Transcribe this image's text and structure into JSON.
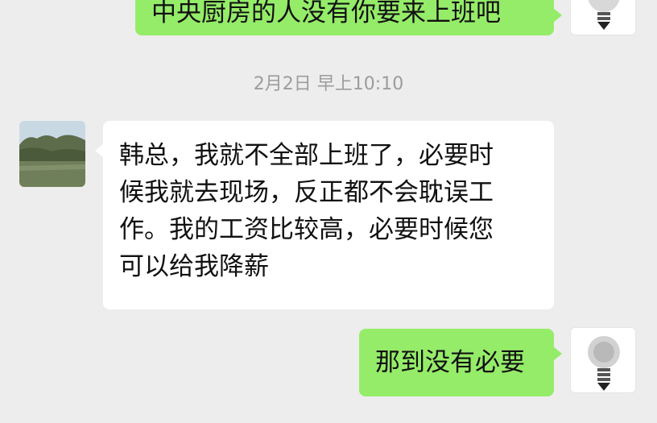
{
  "chat": {
    "messages": [
      {
        "sender": "self",
        "text": "中央厨房的人没有你要来上班吧"
      },
      {
        "sender": "other",
        "lines": [
          "韩总，我就不全部上班了，必要时",
          "候我就去现场，反正都不会耽误工",
          "作。我的工资比较高，必要时候您",
          "可以给我降薪"
        ]
      },
      {
        "sender": "self",
        "text": "那到没有必要"
      }
    ],
    "timestamp": "2月2日 早上10:10"
  },
  "colors": {
    "background": "#ededed",
    "outgoing_bubble": "#95ec69",
    "incoming_bubble": "#ffffff",
    "timestamp_text": "#9c9c9c"
  },
  "avatars": {
    "self": "lightbulb-idea-avatar",
    "other": "lake-landscape-avatar"
  }
}
